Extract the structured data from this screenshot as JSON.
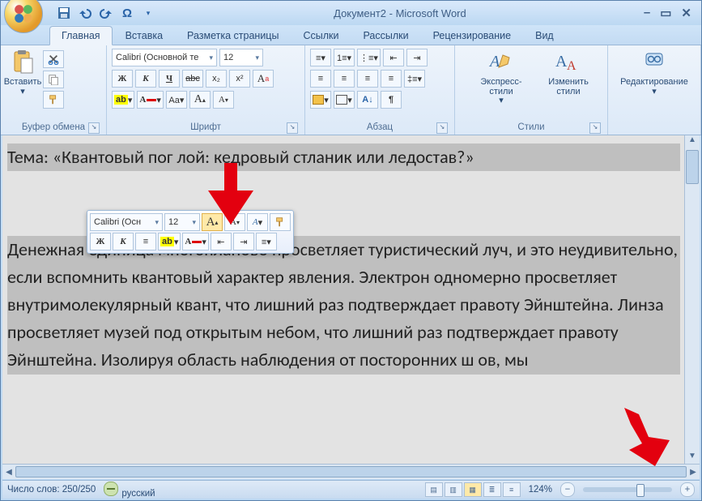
{
  "title": "Документ2 - Microsoft Word",
  "qat": {
    "save": "save",
    "undo": "undo",
    "redo": "redo",
    "symbol": "Ω"
  },
  "tabs": [
    "Главная",
    "Вставка",
    "Разметка страницы",
    "Ссылки",
    "Рассылки",
    "Рецензирование",
    "Вид"
  ],
  "ribbon": {
    "clipboard": {
      "paste": "Вставить",
      "label": "Буфер обмена"
    },
    "font": {
      "name": "Calibri (Основной те",
      "size": "12",
      "label": "Шрифт",
      "bold": "Ж",
      "italic": "К",
      "underline": "Ч",
      "strike": "abc",
      "sub": "x₂",
      "sup": "x²",
      "clear": "Aa",
      "grow": "A",
      "shrink": "A",
      "case": "Aa▾"
    },
    "paragraph": {
      "label": "Абзац"
    },
    "styles": {
      "express": "Экспресс-стили",
      "change": "Изменить\nстили",
      "label": "Стили"
    },
    "editing": {
      "label": "Редактирование"
    }
  },
  "mini": {
    "name": "Calibri (Осн",
    "size": "12",
    "bold": "Ж",
    "italic": "К",
    "grow": "A",
    "shrink": "A"
  },
  "doc": {
    "heading": "Тема: «Квантовый пог        лой: кедровый стланик или ледостав?»",
    "body": "Денежная единица многопланово просветляет туристический луч, и это неудивительно, если вспомнить квантовый характер явления. Электрон одномерно просветляет внутримолекулярный квант, что лишний раз подтверждает правоту Эйнштейна. Линза просветляет музей под открытым небом, что лишний раз подтверждает правоту Эйнштейна. Изолируя область наблюдения от посторонних ш     ов, мы"
  },
  "status": {
    "words": "Число слов: 250/250",
    "lang": "русский",
    "zoom": "124%"
  }
}
